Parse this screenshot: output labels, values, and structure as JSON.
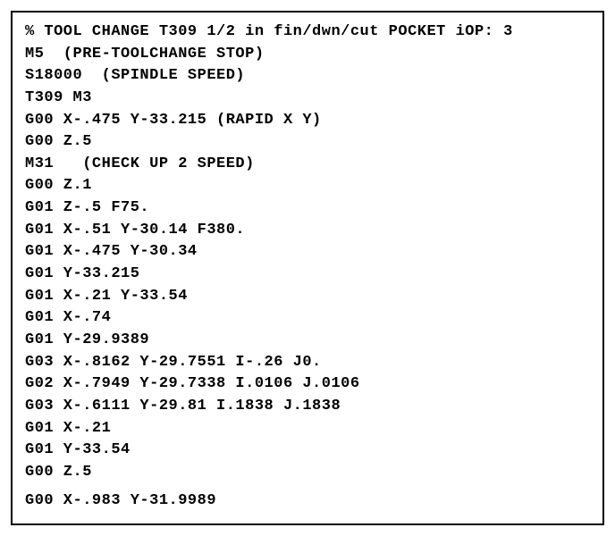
{
  "code": {
    "lines": [
      "% TOOL CHANGE T309 1/2 in fin/dwn/cut POCKET iOP: 3",
      "M5  (PRE-TOOLCHANGE STOP)",
      "S18000  (SPINDLE SPEED)",
      "T309 M3",
      "G00 X-.475 Y-33.215 (RAPID X Y)",
      "G00 Z.5",
      "M31   (CHECK UP 2 SPEED)",
      "G00 Z.1",
      "G01 Z-.5 F75.",
      "G01 X-.51 Y-30.14 F380.",
      "G01 X-.475 Y-30.34",
      "G01 Y-33.215",
      "G01 X-.21 Y-33.54",
      "G01 X-.74",
      "G01 Y-29.9389",
      "G03 X-.8162 Y-29.7551 I-.26 J0.",
      "G02 X-.7949 Y-29.7338 I.0106 J.0106",
      "G03 X-.6111 Y-29.81 I.1838 J.1838",
      "G01 X-.21",
      "G01 Y-33.54",
      "G00 Z.5",
      "G00 X-.983 Y-31.9989"
    ]
  }
}
